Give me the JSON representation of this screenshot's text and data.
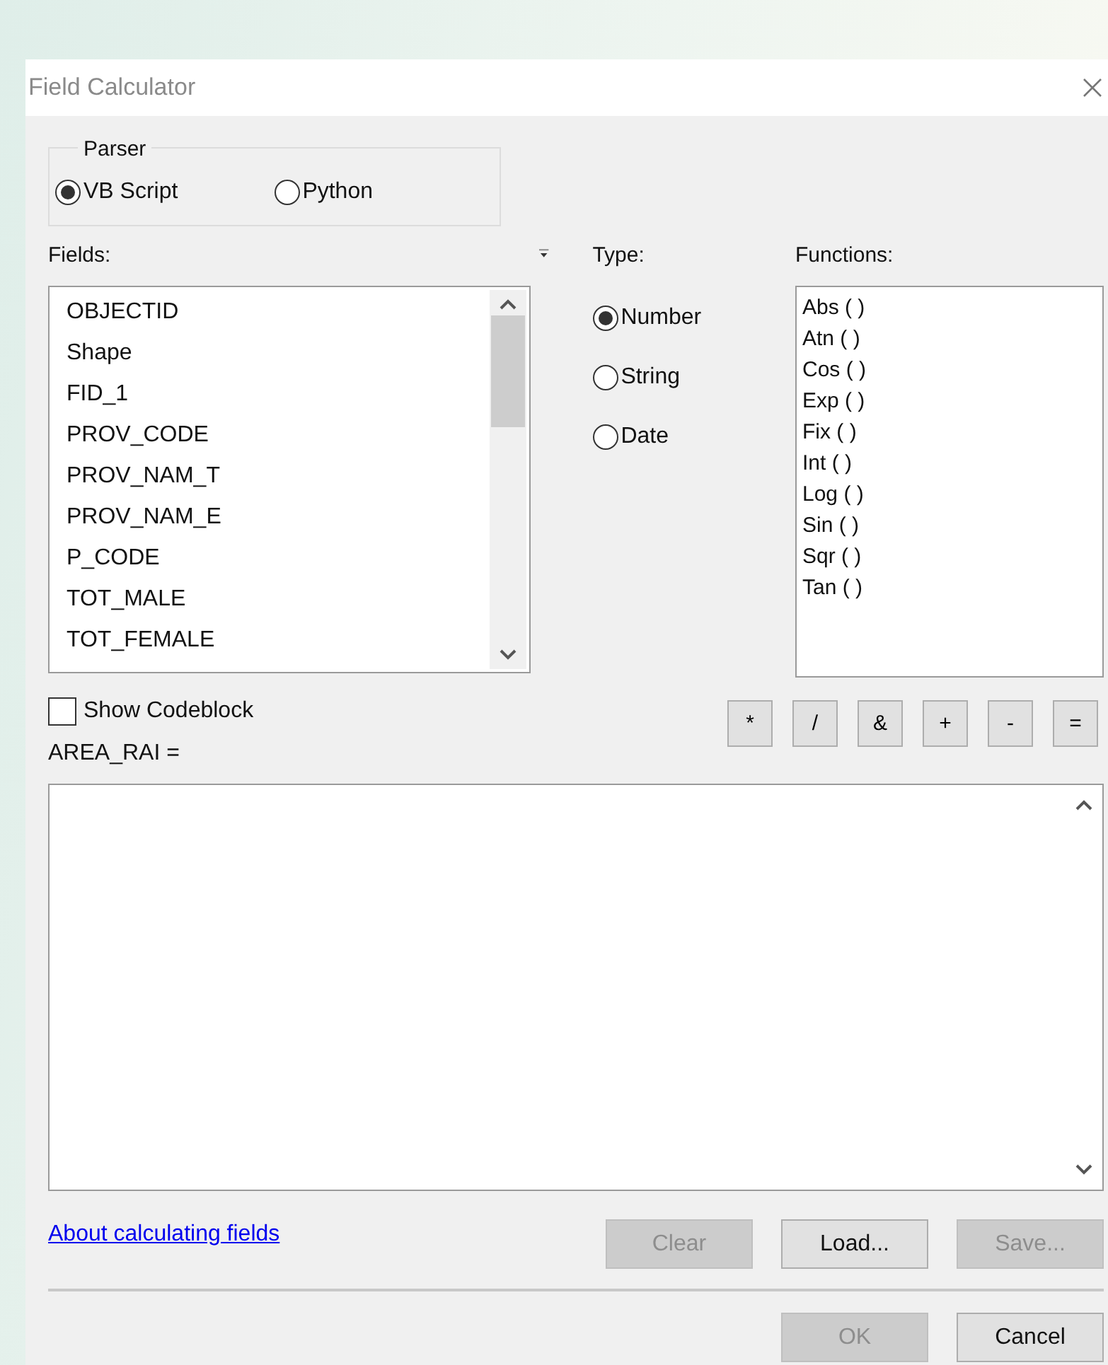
{
  "window": {
    "title": "Field Calculator"
  },
  "parser": {
    "label": "Parser",
    "options": [
      {
        "label": "VB Script",
        "selected": true
      },
      {
        "label": "Python",
        "selected": false
      }
    ]
  },
  "fields": {
    "label": "Fields:",
    "items": [
      "OBJECTID",
      "Shape",
      "FID_1",
      "PROV_CODE",
      "PROV_NAM_T",
      "PROV_NAM_E",
      "P_CODE",
      "TOT_MALE",
      "TOT_FEMALE"
    ]
  },
  "type": {
    "label": "Type:",
    "options": [
      {
        "label": "Number",
        "selected": true
      },
      {
        "label": "String",
        "selected": false
      },
      {
        "label": "Date",
        "selected": false
      }
    ]
  },
  "functions": {
    "label": "Functions:",
    "items": [
      "Abs ( )",
      "Atn ( )",
      "Cos ( )",
      "Exp ( )",
      "Fix ( )",
      "Int ( )",
      "Log ( )",
      "Sin ( )",
      "Sqr ( )",
      "Tan ( )"
    ]
  },
  "show_codeblock": {
    "label": "Show Codeblock",
    "checked": false
  },
  "operators": [
    "*",
    "/",
    "&",
    "+",
    "-",
    "="
  ],
  "expression": {
    "label": "AREA_RAI ="
  },
  "link": "About calculating fields",
  "buttons": [
    {
      "label": "Clear",
      "disabled": true
    },
    {
      "label": "Load...",
      "disabled": false
    },
    {
      "label": "Save...",
      "disabled": true
    }
  ],
  "footer_buttons": [
    {
      "label": "OK",
      "disabled": true
    },
    {
      "label": "Cancel",
      "disabled": false
    }
  ]
}
